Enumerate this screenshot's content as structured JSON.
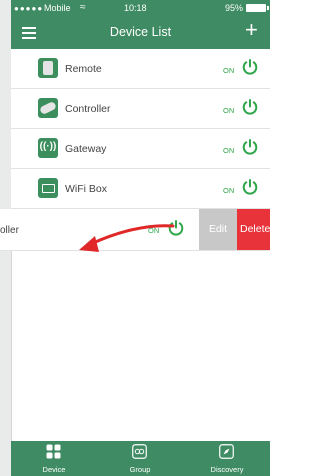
{
  "status_bar": {
    "signal": "●●●●●",
    "carrier": "Mobile",
    "wifi": "≈",
    "time": "10:18",
    "battery": "95%"
  },
  "header": {
    "title": "Device List",
    "add_label": "+"
  },
  "devices": [
    {
      "name": "Remote",
      "state": "ON",
      "icon": "remote-icon"
    },
    {
      "name": "Controller",
      "state": "ON",
      "icon": "controller-icon"
    },
    {
      "name": "Gateway",
      "state": "ON",
      "icon": "gateway-icon"
    },
    {
      "name": "WiFi Box",
      "state": "ON",
      "icon": "wifi-box-icon"
    }
  ],
  "swiped_row": {
    "name_fragment": "oller",
    "state": "ON",
    "edit_label": "Edit",
    "delete_label": "Delete"
  },
  "tabs": [
    {
      "label": "Device",
      "icon": "device-grid-icon"
    },
    {
      "label": "Group",
      "icon": "group-icon"
    },
    {
      "label": "Discovery",
      "icon": "discovery-icon"
    }
  ],
  "colors": {
    "primary": "#3f8b63",
    "on_green": "#2fa64a",
    "delete_red": "#e8333a",
    "edit_gray": "#c8c8c8",
    "arrow_red": "#e02828"
  }
}
